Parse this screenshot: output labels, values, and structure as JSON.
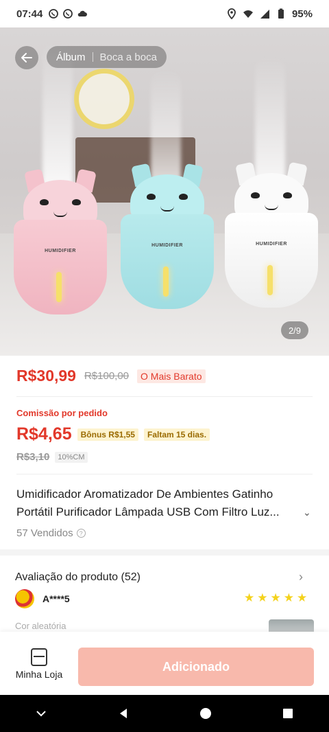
{
  "status_bar": {
    "time": "07:44",
    "battery": "95%",
    "icons": [
      "whatsapp-icon",
      "whatsapp-icon",
      "cloud-icon",
      "location-icon",
      "wifi-icon",
      "signal-icon",
      "battery-icon"
    ]
  },
  "gallery": {
    "tabs": [
      "Álbum",
      "Boca a boca"
    ],
    "counter": "2/9",
    "product_label": "HUMIDIFIER"
  },
  "price": {
    "current": "R$30,99",
    "original": "R$100,00",
    "badge": "O Mais Barato"
  },
  "commission": {
    "title": "Comissão por pedido",
    "amount": "R$4,65",
    "bonus": "Bônus R$1,55",
    "deadline": "Faltam 15 dias.",
    "original": "R$3,10",
    "rate": "10%CM"
  },
  "product": {
    "title": "Umidificador Aromatizador De Ambientes Gatinho Portátil Purificador Lâmpada USB Com Filtro Luz...",
    "sold": "57 Vendidos"
  },
  "reviews": {
    "title": "Avaliação do produto (52)",
    "reviewer": "A****5",
    "stars": 5,
    "variant": "Cor aleatória"
  },
  "bottom": {
    "store_label": "Minha Loja",
    "action_label": "Adicionado"
  },
  "colors": {
    "accent": "#e2382a",
    "button_disabled": "#f8b9ac",
    "star": "#f4d21b"
  }
}
